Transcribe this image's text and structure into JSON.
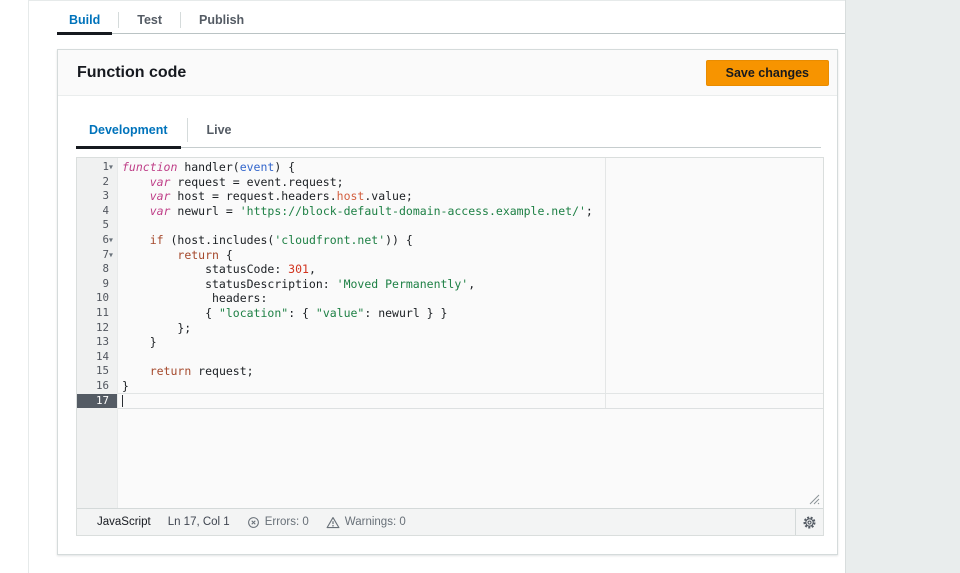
{
  "top_tabs": [
    {
      "label": "Build",
      "active": true
    },
    {
      "label": "Test",
      "active": false
    },
    {
      "label": "Publish",
      "active": false
    }
  ],
  "panel": {
    "title": "Function code",
    "save_button": "Save changes"
  },
  "editor_tabs": [
    {
      "label": "Development",
      "active": true
    },
    {
      "label": "Live",
      "active": false
    }
  ],
  "editor": {
    "active_line": 17,
    "cursor": {
      "line": 17,
      "col": 1
    },
    "lines": [
      {
        "n": 1,
        "fold": true,
        "tokens": [
          [
            "kw1",
            "function"
          ],
          [
            "pl",
            " handler("
          ],
          [
            "param",
            "event"
          ],
          [
            "pl",
            ") {"
          ]
        ]
      },
      {
        "n": 2,
        "tokens": [
          [
            "pl",
            "    "
          ],
          [
            "kw1",
            "var"
          ],
          [
            "pl",
            " request = event.request;"
          ]
        ]
      },
      {
        "n": 3,
        "tokens": [
          [
            "pl",
            "    "
          ],
          [
            "kw1",
            "var"
          ],
          [
            "pl",
            " host = request.headers."
          ],
          [
            "prop",
            "host"
          ],
          [
            "pl",
            ".value;"
          ]
        ]
      },
      {
        "n": 4,
        "tokens": [
          [
            "pl",
            "    "
          ],
          [
            "kw1",
            "var"
          ],
          [
            "pl",
            " newurl = "
          ],
          [
            "str",
            "'https://block-default-domain-access.example.net/'"
          ],
          [
            "pl",
            ";"
          ]
        ]
      },
      {
        "n": 5,
        "tokens": []
      },
      {
        "n": 6,
        "fold": true,
        "tokens": [
          [
            "pl",
            "    "
          ],
          [
            "kw2",
            "if"
          ],
          [
            "pl",
            " (host.includes("
          ],
          [
            "str",
            "'cloudfront.net'"
          ],
          [
            "pl",
            ")) {"
          ]
        ]
      },
      {
        "n": 7,
        "fold": true,
        "tokens": [
          [
            "pl",
            "        "
          ],
          [
            "kw2",
            "return"
          ],
          [
            "pl",
            " {"
          ]
        ]
      },
      {
        "n": 8,
        "tokens": [
          [
            "pl",
            "            statusCode: "
          ],
          [
            "num",
            "301"
          ],
          [
            "pl",
            ","
          ]
        ]
      },
      {
        "n": 9,
        "tokens": [
          [
            "pl",
            "            statusDescription: "
          ],
          [
            "str",
            "'Moved Permanently'"
          ],
          [
            "pl",
            ","
          ]
        ]
      },
      {
        "n": 10,
        "tokens": [
          [
            "pl",
            "             headers:"
          ]
        ]
      },
      {
        "n": 11,
        "tokens": [
          [
            "pl",
            "            { "
          ],
          [
            "str",
            "\"location\""
          ],
          [
            "pl",
            ": { "
          ],
          [
            "str",
            "\"value\""
          ],
          [
            "pl",
            ": newurl } }"
          ]
        ]
      },
      {
        "n": 12,
        "tokens": [
          [
            "pl",
            "        };"
          ]
        ]
      },
      {
        "n": 13,
        "tokens": [
          [
            "pl",
            "    }"
          ]
        ]
      },
      {
        "n": 14,
        "tokens": []
      },
      {
        "n": 15,
        "tokens": [
          [
            "pl",
            "    "
          ],
          [
            "kw2",
            "return"
          ],
          [
            "pl",
            " request;"
          ]
        ]
      },
      {
        "n": 16,
        "tokens": [
          [
            "pl",
            "}"
          ]
        ]
      },
      {
        "n": 17,
        "tokens": []
      }
    ],
    "status": {
      "language": "JavaScript",
      "position": "Ln 17, Col 1",
      "errors": "Errors: 0",
      "warnings": "Warnings: 0"
    }
  },
  "colors": {
    "primary_button": "#f79400",
    "active_tab_text": "#0073bb",
    "active_tab_underline": "#16191f",
    "gutter_active_bg": "#545b64",
    "code_string": "#1e8045",
    "code_number": "#d1341f",
    "code_keyword": "#bf3f88",
    "code_keyword2": "#a5492c",
    "code_property": "#d35f3f",
    "code_param": "#3366cc"
  }
}
